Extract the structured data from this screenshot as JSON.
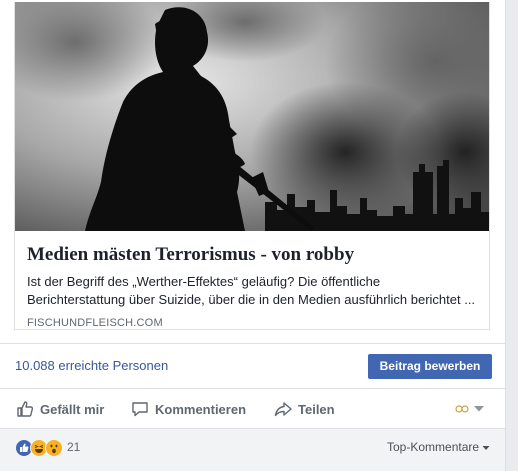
{
  "link_card": {
    "image_alt": "Silhouette eines bewaffneten Soldaten vor Rauch und Skyline",
    "headline": "Medien mästen Terrorismus - von robby",
    "description": "Ist der Begriff des „Werther-Effektes“ geläufig? Die öffentliche Berichterstattung über Suizide, über die in den Medien ausführlich berichtet ...",
    "domain": "FISCHUNDFLEISCH.COM"
  },
  "insights": {
    "reach_text": "10.088 erreichte Personen",
    "promote_label": "Beitrag bewerben"
  },
  "actions": {
    "like_label": "Gefällt mir",
    "comment_label": "Kommentieren",
    "share_label": "Teilen",
    "like_icon": "thumbs-up-icon",
    "comment_icon": "speech-bubble-icon",
    "share_icon": "share-arrow-icon"
  },
  "reactions": {
    "count": "21",
    "types": [
      "like",
      "haha",
      "wow"
    ],
    "sort_label": "Top-Kommentare"
  },
  "colors": {
    "link_blue": "#365899",
    "button_blue": "#4267b2",
    "text_grey": "#606770",
    "headline_dark": "#1d2129"
  }
}
